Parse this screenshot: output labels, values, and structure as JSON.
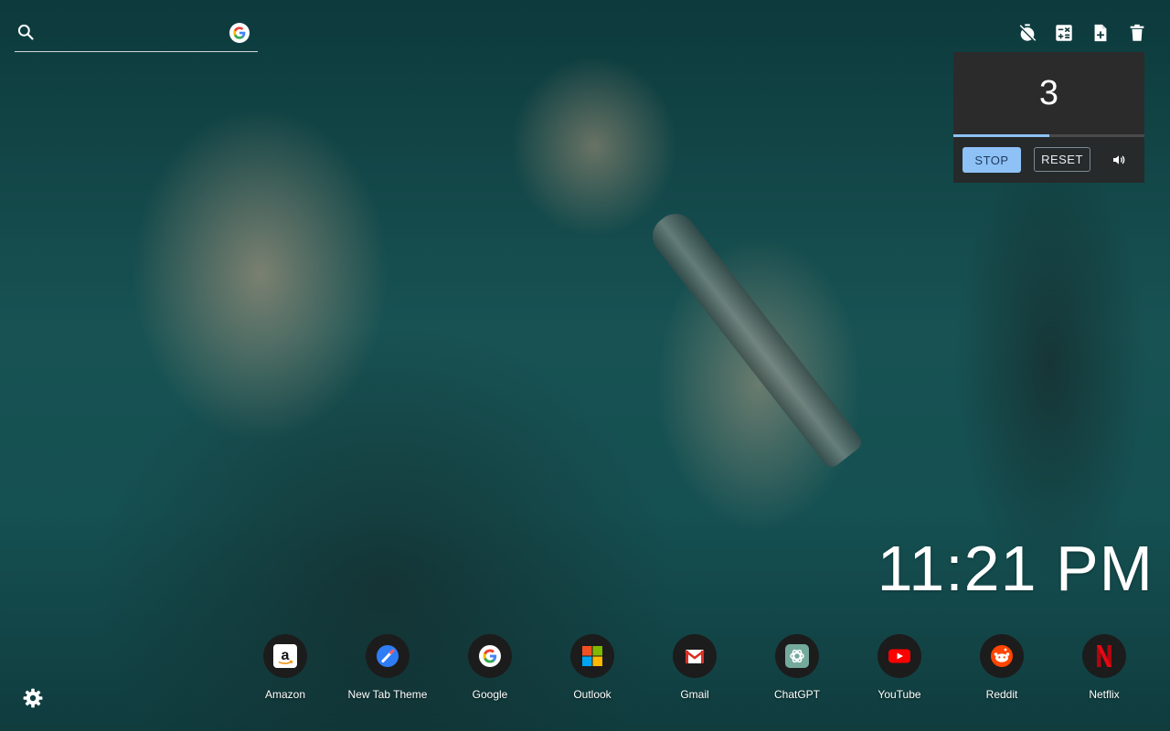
{
  "search": {
    "placeholder": "",
    "value": "",
    "engine_icon": "google-icon"
  },
  "toolbar": [
    {
      "name": "timer-off-icon"
    },
    {
      "name": "calculator-icon"
    },
    {
      "name": "note-add-icon"
    },
    {
      "name": "trash-icon"
    }
  ],
  "timer": {
    "value": "3",
    "progress": 0.5,
    "stop_label": "STOP",
    "reset_label": "RESET",
    "sound_icon": "volume-icon"
  },
  "clock": {
    "time": "11:21 PM"
  },
  "shortcuts": [
    {
      "label": "Amazon",
      "icon": "amazon-icon"
    },
    {
      "label": "New Tab Theme",
      "icon": "new-tab-theme-icon"
    },
    {
      "label": "Google",
      "icon": "google-icon"
    },
    {
      "label": "Outlook",
      "icon": "microsoft-icon"
    },
    {
      "label": "Gmail",
      "icon": "gmail-icon"
    },
    {
      "label": "ChatGPT",
      "icon": "chatgpt-icon"
    },
    {
      "label": "YouTube",
      "icon": "youtube-icon"
    },
    {
      "label": "Reddit",
      "icon": "reddit-icon"
    },
    {
      "label": "Netflix",
      "icon": "netflix-icon"
    }
  ],
  "settings": {
    "icon": "gear-icon"
  },
  "colors": {
    "accent": "#8ec2f7",
    "timer_bg": "#2b2b2b",
    "shortcut_bg": "#1c1c1c"
  }
}
